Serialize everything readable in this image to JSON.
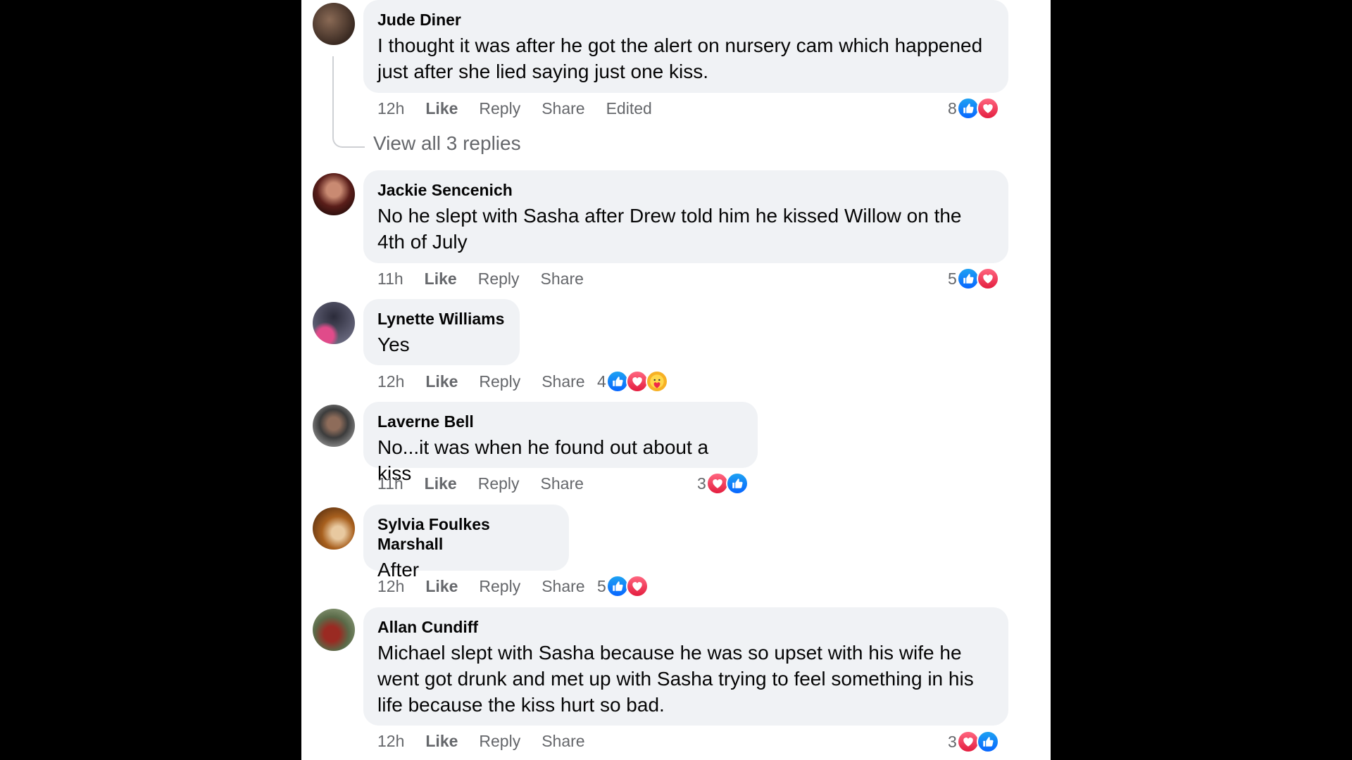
{
  "comments": [
    {
      "author": "Jude Diner",
      "text": "I thought it was after he got the alert on nursery cam which happened just after she lied saying just one kiss.",
      "time": "12h",
      "like": "Like",
      "reply": "Reply",
      "share": "Share",
      "edited": "Edited",
      "reaction_count": "8",
      "reactions": [
        "like-icon",
        "love-icon"
      ]
    },
    {
      "author": "Jackie Sencenich",
      "text": "No he slept with Sasha after Drew told him he kissed Willow on the 4th of July",
      "time": "11h",
      "like": "Like",
      "reply": "Reply",
      "share": "Share",
      "reaction_count": "5",
      "reactions": [
        "like-icon",
        "love-icon"
      ]
    },
    {
      "author": "Lynette Williams",
      "text": "Yes",
      "time": "12h",
      "like": "Like",
      "reply": "Reply",
      "share": "Share",
      "reaction_count": "4",
      "reactions": [
        "like-icon",
        "love-icon",
        "care-icon"
      ]
    },
    {
      "author": "Laverne Bell",
      "text": "No...it was when he found out about a kiss",
      "time": "11h",
      "like": "Like",
      "reply": "Reply",
      "share": "Share",
      "reaction_count": "3",
      "reactions": [
        "love-icon",
        "like-icon"
      ]
    },
    {
      "author": "Sylvia Foulkes Marshall",
      "text": "After",
      "time": "12h",
      "like": "Like",
      "reply": "Reply",
      "share": "Share",
      "reaction_count": "5",
      "reactions": [
        "like-icon",
        "love-icon"
      ]
    },
    {
      "author": "Allan Cundiff",
      "text": "Michael slept with Sasha because he was so upset with his wife he went got drunk and met up with Sasha trying to feel something in his life because the kiss hurt so bad.",
      "time": "12h",
      "like": "Like",
      "reply": "Reply",
      "share": "Share",
      "reaction_count": "3",
      "reactions": [
        "love-icon",
        "like-icon"
      ]
    }
  ],
  "view_replies": "View all 3 replies",
  "colors": {
    "bubble": "#f0f2f5",
    "meta_text": "#65676b",
    "like_blue": "#0866ff",
    "love_red": "#e41e3f"
  }
}
